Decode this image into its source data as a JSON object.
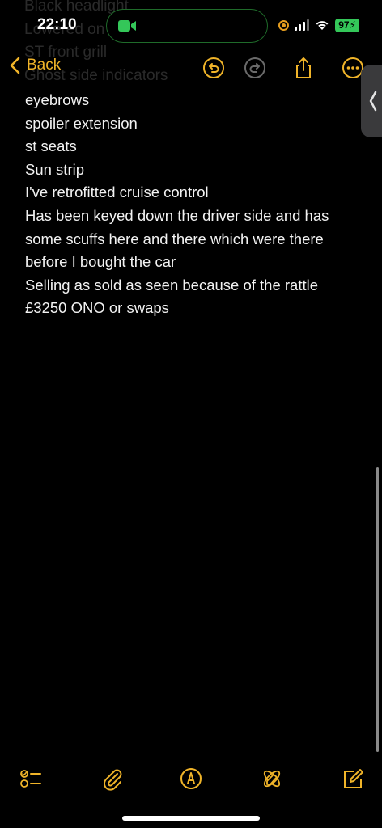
{
  "status_bar": {
    "time": "22:10",
    "battery": "97"
  },
  "nav": {
    "back_label": "Back"
  },
  "note": {
    "scrolled_lines": [
      "Black headlight",
      "Lowered on coilovers",
      "ST front grill",
      "Ghost side indicators"
    ],
    "lines": [
      "eyebrows",
      "spoiler extension",
      "st seats",
      "Sun strip",
      "I've retrofitted cruise control",
      "Has been keyed down the driver side and has",
      "some scuffs here and there which were there",
      "before I bought the car",
      "Selling as sold as seen because of the rattle",
      "£3250 ONO or swaps"
    ]
  },
  "colors": {
    "accent": "#f0b429",
    "background": "#000000",
    "text": "#f2f2f2",
    "battery": "#34c759"
  },
  "icons": {
    "undo": "undo-icon",
    "redo": "redo-icon",
    "share": "share-icon",
    "more": "more-icon",
    "checklist": "checklist-icon",
    "attachment": "paperclip-icon",
    "markup": "markup-pen-icon",
    "writing_tools": "writing-tools-icon",
    "compose": "compose-icon"
  }
}
